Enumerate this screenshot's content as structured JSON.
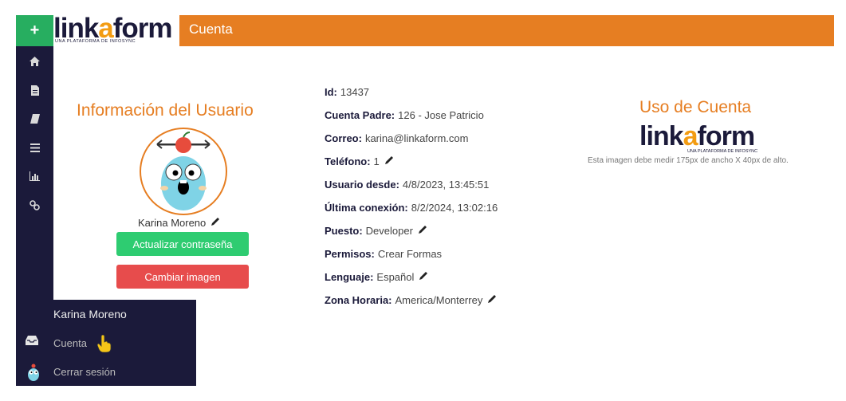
{
  "header": {
    "add_label": "+",
    "logo_text_1": "link",
    "logo_text_o": "a",
    "logo_text_2": "form",
    "logo_sub": "UNA PLATAFORMA DE INFOSYNC",
    "title": "Cuenta",
    "accent": "#e67e22"
  },
  "sidebar": {
    "icons": [
      "home-icon",
      "file-icon",
      "book-icon",
      "list-icon",
      "chart-icon",
      "link-icon"
    ]
  },
  "user_menu": {
    "name": "Karina Moreno",
    "items": [
      {
        "icon": "inbox-icon",
        "label": "Cuenta"
      },
      {
        "icon": "gopher-avatar-icon",
        "label": "Cerrar sesión"
      }
    ]
  },
  "profile": {
    "section_title": "Información del Usuario",
    "name": "Karina Moreno",
    "update_password": "Actualizar contraseña",
    "change_image": "Cambiar imagen"
  },
  "details": [
    {
      "label": "Id:",
      "value": "13437",
      "editable": false
    },
    {
      "label": "Cuenta Padre:",
      "value": "126 - Jose Patricio",
      "editable": false
    },
    {
      "label": "Correo:",
      "value": "karina@linkaform.com",
      "editable": false
    },
    {
      "label": "Teléfono:",
      "value": "1",
      "editable": true
    },
    {
      "label": "Usuario desde:",
      "value": "4/8/2023, 13:45:51",
      "editable": false
    },
    {
      "label": "Última conexión:",
      "value": "8/2/2024, 13:02:16",
      "editable": false
    },
    {
      "label": "Puesto:",
      "value": "Developer",
      "editable": true
    },
    {
      "label": "Permisos:",
      "value": "Crear Formas",
      "editable": false
    },
    {
      "label": "Lenguaje:",
      "value": "Español",
      "editable": true
    },
    {
      "label": "Zona Horaria:",
      "value": "America/Monterrey",
      "editable": true
    }
  ],
  "usage": {
    "title": "Uso de Cuenta",
    "logo_text_1": "link",
    "logo_text_o": "a",
    "logo_text_2": "form",
    "logo_sub": "UNA PLATAFORMA DE INFOSYNC",
    "note": "Esta imagen debe medir 175px de ancho X 40px de alto."
  }
}
